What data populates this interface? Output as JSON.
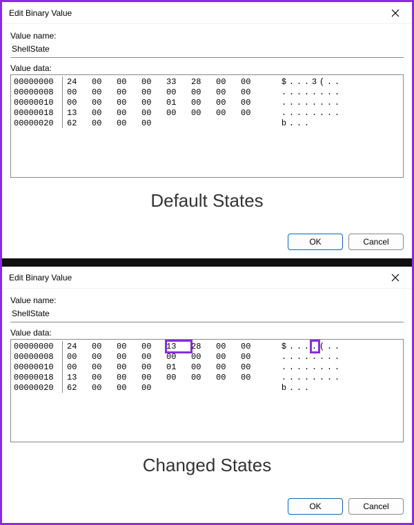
{
  "dialog_title": "Edit Binary Value",
  "labels": {
    "value_name": "Value name:",
    "value_data": "Value data:"
  },
  "value_name": "ShellState",
  "buttons": {
    "ok": "OK",
    "cancel": "Cancel"
  },
  "captions": {
    "top": "Default States",
    "bottom": "Changed States"
  },
  "hex_top": {
    "rows": [
      {
        "offset": "00000000",
        "bytes": [
          "24",
          "00",
          "00",
          "00",
          "33",
          "28",
          "00",
          "00"
        ],
        "ascii": [
          "$",
          ".",
          ".",
          ".",
          "3",
          "(",
          ".",
          "."
        ]
      },
      {
        "offset": "00000008",
        "bytes": [
          "00",
          "00",
          "00",
          "00",
          "00",
          "00",
          "00",
          "00"
        ],
        "ascii": [
          ".",
          ".",
          ".",
          ".",
          ".",
          ".",
          ".",
          "."
        ]
      },
      {
        "offset": "00000010",
        "bytes": [
          "00",
          "00",
          "00",
          "00",
          "01",
          "00",
          "00",
          "00"
        ],
        "ascii": [
          ".",
          ".",
          ".",
          ".",
          ".",
          ".",
          ".",
          "."
        ]
      },
      {
        "offset": "00000018",
        "bytes": [
          "13",
          "00",
          "00",
          "00",
          "00",
          "00",
          "00",
          "00"
        ],
        "ascii": [
          ".",
          ".",
          ".",
          ".",
          ".",
          ".",
          ".",
          "."
        ]
      },
      {
        "offset": "00000020",
        "bytes": [
          "62",
          "00",
          "00",
          "00"
        ],
        "ascii": [
          "b",
          ".",
          ".",
          "."
        ]
      }
    ]
  },
  "hex_bottom": {
    "rows": [
      {
        "offset": "00000000",
        "bytes": [
          "24",
          "00",
          "00",
          "00",
          "13",
          "28",
          "00",
          "00"
        ],
        "ascii": [
          "$",
          ".",
          ".",
          ".",
          ".",
          "(",
          ".",
          "."
        ],
        "hl_byte": 4,
        "hl_ascii": 4
      },
      {
        "offset": "00000008",
        "bytes": [
          "00",
          "00",
          "00",
          "00",
          "00",
          "00",
          "00",
          "00"
        ],
        "ascii": [
          ".",
          ".",
          ".",
          ".",
          ".",
          ".",
          ".",
          "."
        ]
      },
      {
        "offset": "00000010",
        "bytes": [
          "00",
          "00",
          "00",
          "00",
          "01",
          "00",
          "00",
          "00"
        ],
        "ascii": [
          ".",
          ".",
          ".",
          ".",
          ".",
          ".",
          ".",
          "."
        ]
      },
      {
        "offset": "00000018",
        "bytes": [
          "13",
          "00",
          "00",
          "00",
          "00",
          "00",
          "00",
          "00"
        ],
        "ascii": [
          ".",
          ".",
          ".",
          ".",
          ".",
          ".",
          ".",
          "."
        ]
      },
      {
        "offset": "00000020",
        "bytes": [
          "62",
          "00",
          "00",
          "00"
        ],
        "ascii": [
          "b",
          ".",
          ".",
          "."
        ]
      }
    ]
  }
}
